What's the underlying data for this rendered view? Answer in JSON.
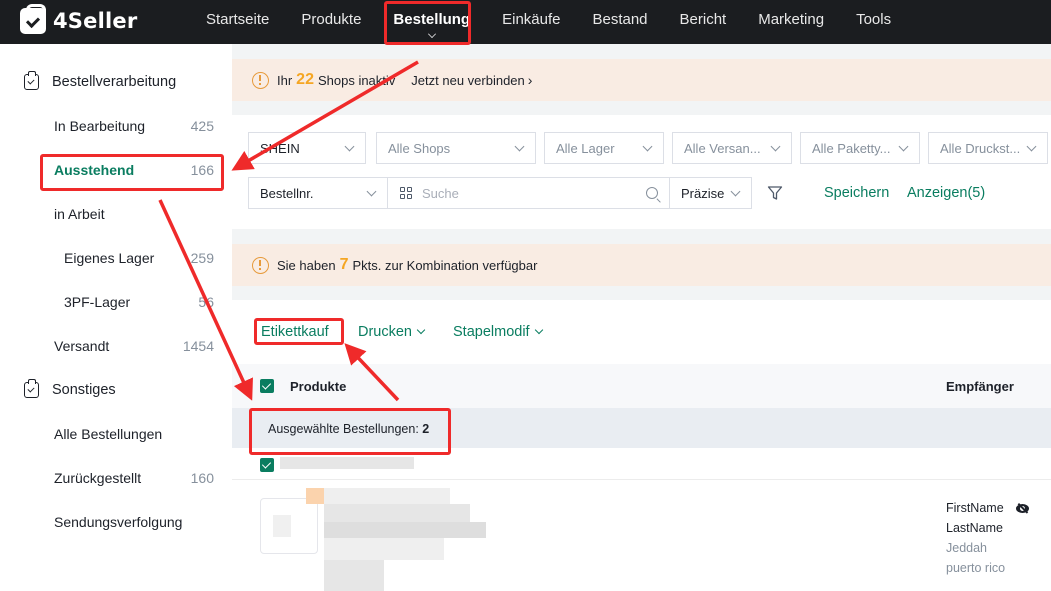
{
  "app": {
    "brand": "4Seller"
  },
  "nav": {
    "items": [
      "Startseite",
      "Produkte",
      "Bestellung",
      "Einkäufe",
      "Bestand",
      "Bericht",
      "Marketing",
      "Tools"
    ],
    "active": "Bestellung"
  },
  "sidebar": {
    "group1": "Bestellverarbeitung",
    "in_bearbeitung": {
      "label": "In Bearbeitung",
      "count": "425"
    },
    "ausstehend": {
      "label": "Ausstehend",
      "count": "166"
    },
    "in_arbeit": {
      "label": "in Arbeit"
    },
    "eigenes_lager": {
      "label": "Eigenes Lager",
      "count": "259"
    },
    "pf_lager": {
      "label": "3PF-Lager",
      "count": "56"
    },
    "versandt": {
      "label": "Versandt",
      "count": "1454"
    },
    "group2": "Sonstiges",
    "alle_bestellungen": {
      "label": "Alle Bestellungen"
    },
    "zurueckgestellt": {
      "label": "Zurückgestellt",
      "count": "160"
    },
    "sendungsverfolgung": {
      "label": "Sendungsverfolgung"
    }
  },
  "notice1": {
    "pre": "Ihr",
    "num": "22",
    "post": "Shops inaktiv",
    "link": "Jetzt neu verbinden"
  },
  "filters": {
    "platform": "SHEIN",
    "shops": "Alle Shops",
    "lager": "Alle Lager",
    "versand": "Alle Versan...",
    "pakettyp": "Alle Paketty...",
    "druck": "Alle Druckst...",
    "search_field": "Bestellnr.",
    "search_placeholder": "Suche",
    "match": "Präzise",
    "save": "Speichern",
    "show": "Anzeigen(5)"
  },
  "notice2": {
    "pre": "Sie haben",
    "num": "7",
    "post": "Pkts. zur Kombination verfügbar"
  },
  "orders": {
    "actions": {
      "etikettkauf": "Etikettkauf",
      "drucken": "Drucken",
      "stapel": "Stapelmodif"
    },
    "head": {
      "produkte": "Produkte",
      "empfaenger": "Empfänger"
    },
    "selected_label": "Ausgewählte Bestellungen:",
    "selected_count": "2",
    "recipient": {
      "first": "FirstName",
      "last": "LastName",
      "city": "Jeddah",
      "country": "puerto rico"
    }
  },
  "colors": {
    "accent": "#0a7d60",
    "nav_bg": "#1b1d20",
    "notice_bg": "#f9ece3",
    "warn": "#f5a623",
    "annotation": "#ef2a2a"
  }
}
